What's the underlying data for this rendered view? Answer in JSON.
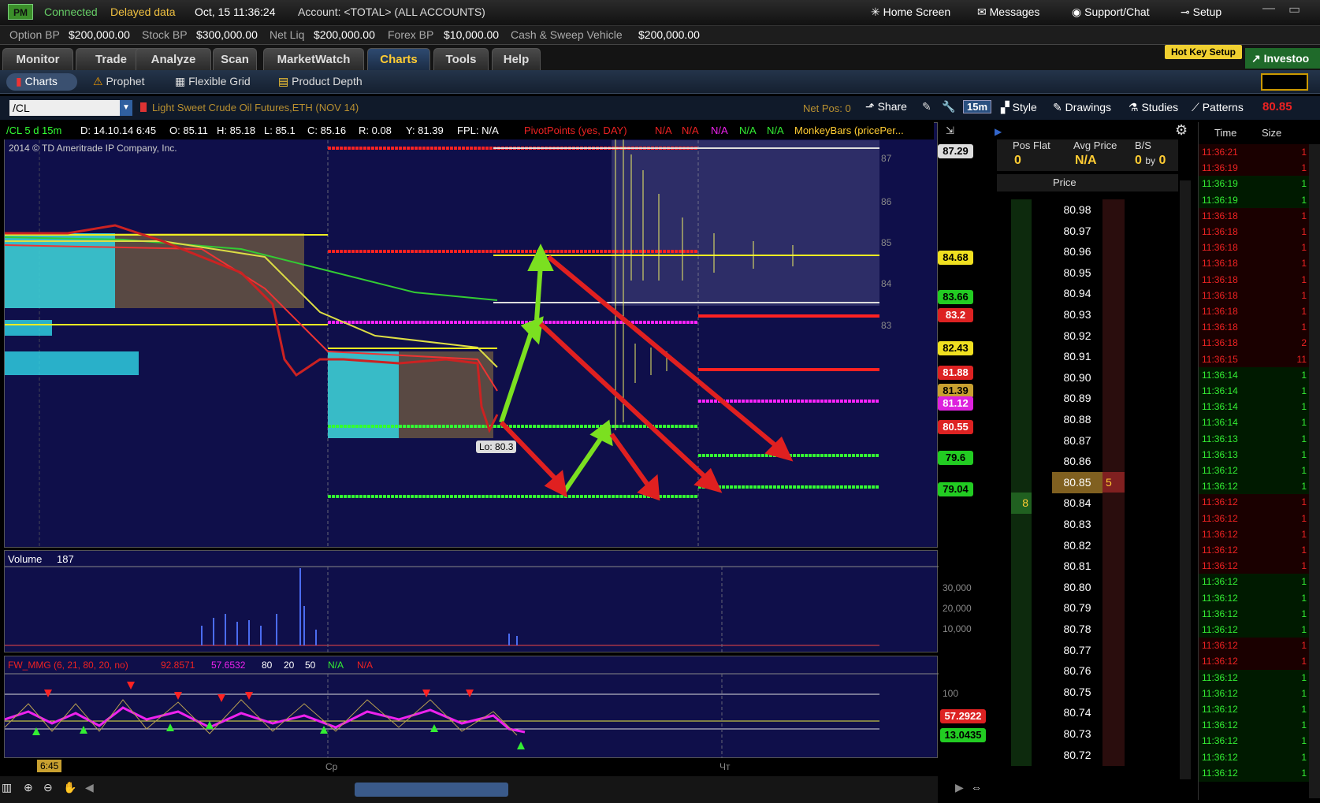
{
  "topbar": {
    "logo": "PM",
    "connected": "Connected",
    "delayed": "Delayed data",
    "datetime": "Oct, 15  11:36:24",
    "account": "Account: <TOTAL> (ALL ACCOUNTS)",
    "home_screen": "Home Screen",
    "messages": "Messages",
    "support": "Support/Chat",
    "setup": "Setup"
  },
  "balances": {
    "option_bp_label": "Option BP",
    "option_bp": "$200,000.00",
    "stock_bp_label": "Stock BP",
    "stock_bp": "$300,000.00",
    "net_liq_label": "Net Liq",
    "net_liq": "$200,000.00",
    "forex_bp_label": "Forex BP",
    "forex_bp": "$10,000.00",
    "sweep_label": "Cash & Sweep Vehicle",
    "sweep": "$200,000.00"
  },
  "tabs": [
    "Monitor",
    "Trade",
    "Analyze",
    "Scan",
    "MarketWatch",
    "Charts",
    "Tools",
    "Help"
  ],
  "hotkey": "Hot Key Setup",
  "investools": "Investoo",
  "subtabs": [
    "Charts",
    "Prophet",
    "Flexible Grid",
    "Product Depth"
  ],
  "symbol": {
    "ticker": "/CL",
    "description": "Light Sweet Crude Oil Futures,ETH (NOV 14)",
    "net_pos": "Net Pos: 0",
    "share": "Share",
    "timeframe": "15m",
    "style": "Style",
    "drawings": "Drawings",
    "studies": "Studies",
    "patterns": "Patterns",
    "last": "80.85"
  },
  "chart_header": {
    "symbol": "/CL 5 d 15m",
    "date": "D: 14.10.14 6:45",
    "open": "O: 85.11",
    "high": "H: 85.18",
    "low": "L: 85.1",
    "close": "C: 85.16",
    "range": "R: 0.08",
    "y": "Y: 81.39",
    "fpl": "FPL: N/A",
    "pivot": "PivotPoints (yes, DAY)",
    "na1": "N/A",
    "na2": "N/A",
    "na3": "N/A",
    "na4": "N/A",
    "na5": "N/A",
    "monkey": "MonkeyBars (pricePer..."
  },
  "copyright": "2014 © TD Ameritrade IP Company, Inc.",
  "low_label": "Lo: 80.3",
  "price_axis": [
    "87",
    "86",
    "85",
    "84",
    "83"
  ],
  "price_tags": [
    {
      "v": "87.29",
      "bg": "#dddddd",
      "fg": "#000"
    },
    {
      "v": "84.68",
      "bg": "#f0e020",
      "fg": "#000"
    },
    {
      "v": "83.66",
      "bg": "#22cc22",
      "fg": "#000"
    },
    {
      "v": "83.2",
      "bg": "#dd2222",
      "fg": "#fff"
    },
    {
      "v": "82.43",
      "bg": "#f0e020",
      "fg": "#000"
    },
    {
      "v": "81.88",
      "bg": "#dd2222",
      "fg": "#fff"
    },
    {
      "v": "81.39",
      "bg": "#c8a030",
      "fg": "#000"
    },
    {
      "v": "81.12",
      "bg": "#dd22dd",
      "fg": "#fff"
    },
    {
      "v": "80.55",
      "bg": "#dd2222",
      "fg": "#fff"
    },
    {
      "v": "79.6",
      "bg": "#22cc22",
      "fg": "#000"
    },
    {
      "v": "79.04",
      "bg": "#22cc22",
      "fg": "#000"
    }
  ],
  "volume": {
    "label": "Volume",
    "value": "187",
    "axis": [
      "30,000",
      "20,000",
      "10,000"
    ]
  },
  "oscillator": {
    "label": "FW_MMG (6, 21, 80, 20, no)",
    "v1": "92.8571",
    "v2": "57.6532",
    "p1": "80",
    "p2": "20",
    "p3": "50",
    "na1": "N/A",
    "na2": "N/A",
    "axis": "100",
    "tag1": "57.2922",
    "tag2": "13.0435"
  },
  "time_axis": {
    "t1": "6:45",
    "t2": "Ср",
    "t3": "Чт"
  },
  "ladder": {
    "pos_flat": "Pos Flat",
    "pos_val": "0",
    "avg_price": "Avg Price",
    "avg_val": "N/A",
    "bs": "B/S",
    "bs_val_a": "0",
    "bs_by": "by",
    "bs_val_b": "0",
    "price_hdr": "Price",
    "prices": [
      "80.98",
      "80.97",
      "80.96",
      "80.95",
      "80.94",
      "80.93",
      "80.92",
      "80.91",
      "80.90",
      "80.89",
      "80.88",
      "80.87",
      "80.86",
      "80.85",
      "80.84",
      "80.83",
      "80.82",
      "80.81",
      "80.80",
      "80.79",
      "80.78",
      "80.77",
      "80.76",
      "80.75",
      "80.74",
      "80.73",
      "80.72"
    ],
    "ask_size": "5",
    "bid_size": "8"
  },
  "tns": {
    "time_hdr": "Time",
    "size_hdr": "Size",
    "rows": [
      {
        "t": "11:36:21",
        "s": "1",
        "c": "r"
      },
      {
        "t": "11:36:19",
        "s": "1",
        "c": "r"
      },
      {
        "t": "11:36:19",
        "s": "1",
        "c": "g"
      },
      {
        "t": "11:36:19",
        "s": "1",
        "c": "g"
      },
      {
        "t": "11:36:18",
        "s": "1",
        "c": "r"
      },
      {
        "t": "11:36:18",
        "s": "1",
        "c": "r"
      },
      {
        "t": "11:36:18",
        "s": "1",
        "c": "r"
      },
      {
        "t": "11:36:18",
        "s": "1",
        "c": "r"
      },
      {
        "t": "11:36:18",
        "s": "1",
        "c": "r"
      },
      {
        "t": "11:36:18",
        "s": "1",
        "c": "r"
      },
      {
        "t": "11:36:18",
        "s": "1",
        "c": "r"
      },
      {
        "t": "11:36:18",
        "s": "1",
        "c": "r"
      },
      {
        "t": "11:36:18",
        "s": "2",
        "c": "r"
      },
      {
        "t": "11:36:15",
        "s": "11",
        "c": "r"
      },
      {
        "t": "11:36:14",
        "s": "1",
        "c": "g"
      },
      {
        "t": "11:36:14",
        "s": "1",
        "c": "g"
      },
      {
        "t": "11:36:14",
        "s": "1",
        "c": "g"
      },
      {
        "t": "11:36:14",
        "s": "1",
        "c": "g"
      },
      {
        "t": "11:36:13",
        "s": "1",
        "c": "g"
      },
      {
        "t": "11:36:13",
        "s": "1",
        "c": "g"
      },
      {
        "t": "11:36:12",
        "s": "1",
        "c": "g"
      },
      {
        "t": "11:36:12",
        "s": "1",
        "c": "g"
      },
      {
        "t": "11:36:12",
        "s": "1",
        "c": "r"
      },
      {
        "t": "11:36:12",
        "s": "1",
        "c": "r"
      },
      {
        "t": "11:36:12",
        "s": "1",
        "c": "r"
      },
      {
        "t": "11:36:12",
        "s": "1",
        "c": "r"
      },
      {
        "t": "11:36:12",
        "s": "1",
        "c": "r"
      },
      {
        "t": "11:36:12",
        "s": "1",
        "c": "g"
      },
      {
        "t": "11:36:12",
        "s": "1",
        "c": "g"
      },
      {
        "t": "11:36:12",
        "s": "1",
        "c": "g"
      },
      {
        "t": "11:36:12",
        "s": "1",
        "c": "g"
      },
      {
        "t": "11:36:12",
        "s": "1",
        "c": "r"
      },
      {
        "t": "11:36:12",
        "s": "1",
        "c": "r"
      },
      {
        "t": "11:36:12",
        "s": "1",
        "c": "g"
      },
      {
        "t": "11:36:12",
        "s": "1",
        "c": "g"
      },
      {
        "t": "11:36:12",
        "s": "1",
        "c": "g"
      },
      {
        "t": "11:36:12",
        "s": "1",
        "c": "g"
      },
      {
        "t": "11:36:12",
        "s": "1",
        "c": "g"
      },
      {
        "t": "11:36:12",
        "s": "1",
        "c": "g"
      },
      {
        "t": "11:36:12",
        "s": "1",
        "c": "g"
      }
    ]
  },
  "colors": {
    "accent": "#ffcc33",
    "red": "#dd2222",
    "green": "#22cc22",
    "chart_bg": "#0f0f4a"
  }
}
